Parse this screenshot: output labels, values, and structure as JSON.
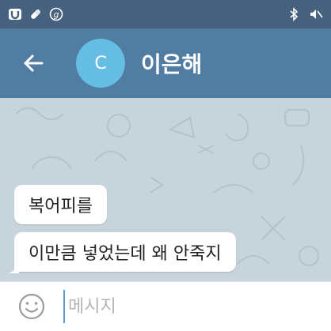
{
  "status_bar": {
    "left_icons": [
      "u-logo-icon",
      "pill-icon",
      "g-circle-icon"
    ],
    "right_icons": [
      "bluetooth-icon",
      "mute-icon"
    ]
  },
  "header": {
    "avatar_letter": "C",
    "title": "이은해",
    "accent": "#527da3",
    "avatar_color": "#65bde3"
  },
  "messages": [
    {
      "text": "복어피를"
    },
    {
      "text": "이만큼 넣었는데 왜 안죽지"
    }
  ],
  "composer": {
    "placeholder": "메시지"
  }
}
